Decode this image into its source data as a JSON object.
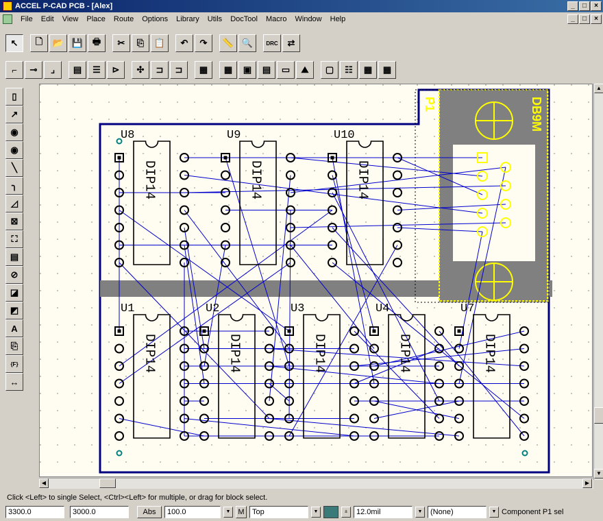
{
  "window": {
    "title": "ACCEL P-CAD PCB - [Alex]",
    "min": "_",
    "max": "□",
    "close": "×"
  },
  "menu": [
    "File",
    "Edit",
    "View",
    "Place",
    "Route",
    "Options",
    "Library",
    "Utils",
    "DocTool",
    "Macro",
    "Window",
    "Help"
  ],
  "toolbar1": [
    {
      "name": "select-tool",
      "glyph": "↖"
    },
    {
      "name": "new-button",
      "glyph": "🗋"
    },
    {
      "name": "open-button",
      "glyph": "📂"
    },
    {
      "name": "save-button",
      "glyph": "💾"
    },
    {
      "name": "print-button",
      "glyph": "🖶"
    },
    {
      "name": "cut-button",
      "glyph": "✂"
    },
    {
      "name": "copy-button",
      "glyph": "⎘"
    },
    {
      "name": "paste-button",
      "glyph": "📋"
    },
    {
      "name": "undo-button",
      "glyph": "↶"
    },
    {
      "name": "redo-button",
      "glyph": "↷"
    },
    {
      "name": "measure-button",
      "glyph": "📏"
    },
    {
      "name": "zoom-button",
      "glyph": "🔍"
    },
    {
      "name": "drc-button",
      "glyph": "DRC"
    },
    {
      "name": "netlist-button",
      "glyph": "⇄"
    }
  ],
  "toolbar2": [
    "route-manual",
    "route-multi",
    "route-bus",
    "route-fanout",
    "route-push",
    "route-miter",
    "route-via",
    "route-dense",
    "route-optimize",
    "route-autorouter",
    "report-table",
    "report-pads",
    "report-layers",
    "report-nets",
    "report-drc",
    "report-hole",
    "report-bom",
    "report-3d",
    "report-extra"
  ],
  "lefttools": [
    "component-tool",
    "connection-tool",
    "pad-tool",
    "via-tool",
    "line-tool",
    "arc-tool",
    "polygon-tool",
    "copper-pour-tool",
    "keepout-tool",
    "cutout-tool",
    "prohibit-tool",
    "field-tool",
    "plane-tool",
    "text-tool",
    "attribute-tool",
    "ref-point-tool",
    "dimension-tool"
  ],
  "lefttool_glyphs": [
    "▯",
    "↗",
    "◉",
    "◉",
    "╲",
    "╮",
    "◿",
    "⊠",
    "⛶",
    "▤",
    "⊘",
    "◪",
    "◩",
    "A",
    "⎘",
    "{F}",
    "↔"
  ],
  "board": {
    "components": [
      {
        "ref": "U8",
        "type": "DIP14"
      },
      {
        "ref": "U9",
        "type": "DIP14"
      },
      {
        "ref": "U10",
        "type": "DIP14"
      },
      {
        "ref": "U1",
        "type": "DIP14"
      },
      {
        "ref": "U2",
        "type": "DIP14"
      },
      {
        "ref": "U3",
        "type": "DIP14"
      },
      {
        "ref": "U4",
        "type": "DIP14"
      },
      {
        "ref": "U7",
        "type": "DIP14"
      }
    ],
    "connector": {
      "ref": "P1",
      "type": "DB9M"
    },
    "colors": {
      "board_bg": "#fffdf2",
      "outline": "#000080",
      "ratsnest": "#0000cc",
      "gray": "#808080",
      "yellow": "#ffff00",
      "pad": "#000000",
      "hole": "#008080"
    }
  },
  "status": {
    "message": "Click <Left> to single Select, <Ctrl><Left> for multiple, or drag for block select.",
    "x": "3300.0",
    "y": "3000.0",
    "abs": "Abs",
    "grid": "100.0",
    "m": "M",
    "layer": "Top",
    "width": "12.0mil",
    "net": "(None)",
    "component": "Component P1 sel"
  }
}
